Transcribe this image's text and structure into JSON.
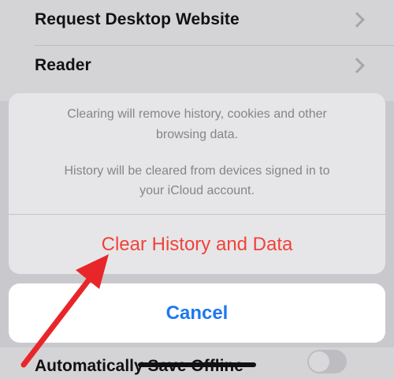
{
  "settings": {
    "items": [
      {
        "label": "Request Desktop Website"
      },
      {
        "label": "Reader"
      }
    ],
    "bottom_item": {
      "label": "Automatically Save Offline",
      "toggle_on": false
    }
  },
  "action_sheet": {
    "message_lines": [
      "Clearing will remove history, cookies and other",
      "browsing data.",
      "History will be cleared from devices signed in to",
      "your iCloud account."
    ],
    "destructive_label": "Clear History and Data",
    "cancel_label": "Cancel"
  },
  "colors": {
    "destructive": "#f0433a",
    "cancel": "#1e78f0",
    "annotation_arrow": "#e8262a"
  }
}
